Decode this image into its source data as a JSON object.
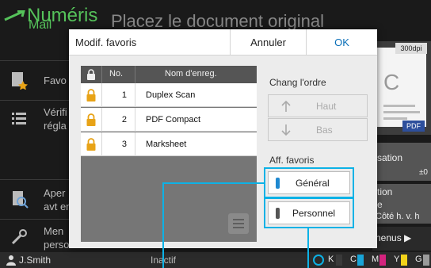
{
  "background": {
    "app_title": "Numéris",
    "app_subtitle": "Mail",
    "instruction": "Placez le document original",
    "side_menu": [
      {
        "label": "Favo",
        "icon": "favorites-star-icon"
      },
      {
        "label": "Vérifi\nrégla",
        "icon": "list-icon"
      },
      {
        "label": "Aper\navt en",
        "icon": "preview-magnifier-icon"
      },
      {
        "label": "Men\nperso",
        "icon": "wrench-icon"
      }
    ],
    "preview": {
      "dpi": "300dpi",
      "format": "PDF",
      "page_letter": "C"
    },
    "right_cards": [
      {
        "line1": "sation",
        "line2": "±0"
      },
      {
        "line1": "tion",
        "line2": "e",
        "line3": "Côté h. v. h"
      },
      {
        "line1": "nenus ▶"
      }
    ],
    "status_bar": {
      "user": "J.Smith",
      "state": "Inactif",
      "inks": [
        {
          "label": "K",
          "color": "#3a3a3a"
        },
        {
          "label": "C",
          "color": "#19a5d8"
        },
        {
          "label": "M",
          "color": "#d4237e"
        },
        {
          "label": "Y",
          "color": "#f2d21a"
        },
        {
          "label": "G",
          "color": "#9a9a9a"
        }
      ]
    }
  },
  "dialog": {
    "title": "Modif. favoris",
    "cancel_label": "Annuler",
    "ok_label": "OK",
    "table": {
      "col_no": "No.",
      "col_name": "Nom d'enreg.",
      "rows": [
        {
          "no": "1",
          "name": "Duplex Scan"
        },
        {
          "no": "2",
          "name": "PDF Compact"
        },
        {
          "no": "3",
          "name": "Marksheet"
        }
      ]
    },
    "order": {
      "label": "Chang l'ordre",
      "up_label": "Haut",
      "down_label": "Bas"
    },
    "fav_display": {
      "label": "Aff. favoris",
      "general_label": "Général",
      "personal_label": "Personnel"
    }
  },
  "colors": {
    "accent": "#0db2e6",
    "ok_text": "#0a6fb8",
    "app_green": "#55c25a",
    "lock_gold": "#e8a317",
    "general_indicator": "#1e88d0",
    "personal_indicator": "#555555"
  }
}
